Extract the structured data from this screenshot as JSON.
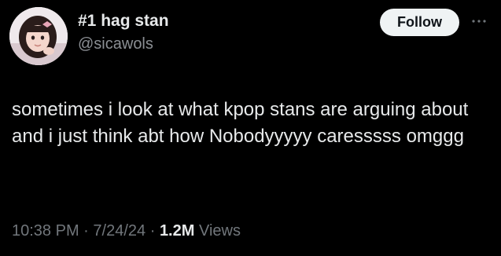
{
  "author": {
    "display_name": "#1 hag stan",
    "handle": "@sicawols"
  },
  "follow_label": "Follow",
  "more_icon": "more-horizontal-icon",
  "tweet": {
    "text": "sometimes i look at what kpop stans are arguing about and i just think abt how Nobodyyyyy caresssss omggg"
  },
  "meta": {
    "time": "10:38 PM",
    "separator": "·",
    "date": "7/24/24",
    "views_count": "1.2M",
    "views_label": "Views"
  },
  "colors": {
    "background": "#000000",
    "primary_text": "#e7e9ea",
    "secondary_text": "#71767b",
    "follow_bg": "#eff3f4",
    "follow_text": "#0f1419"
  }
}
